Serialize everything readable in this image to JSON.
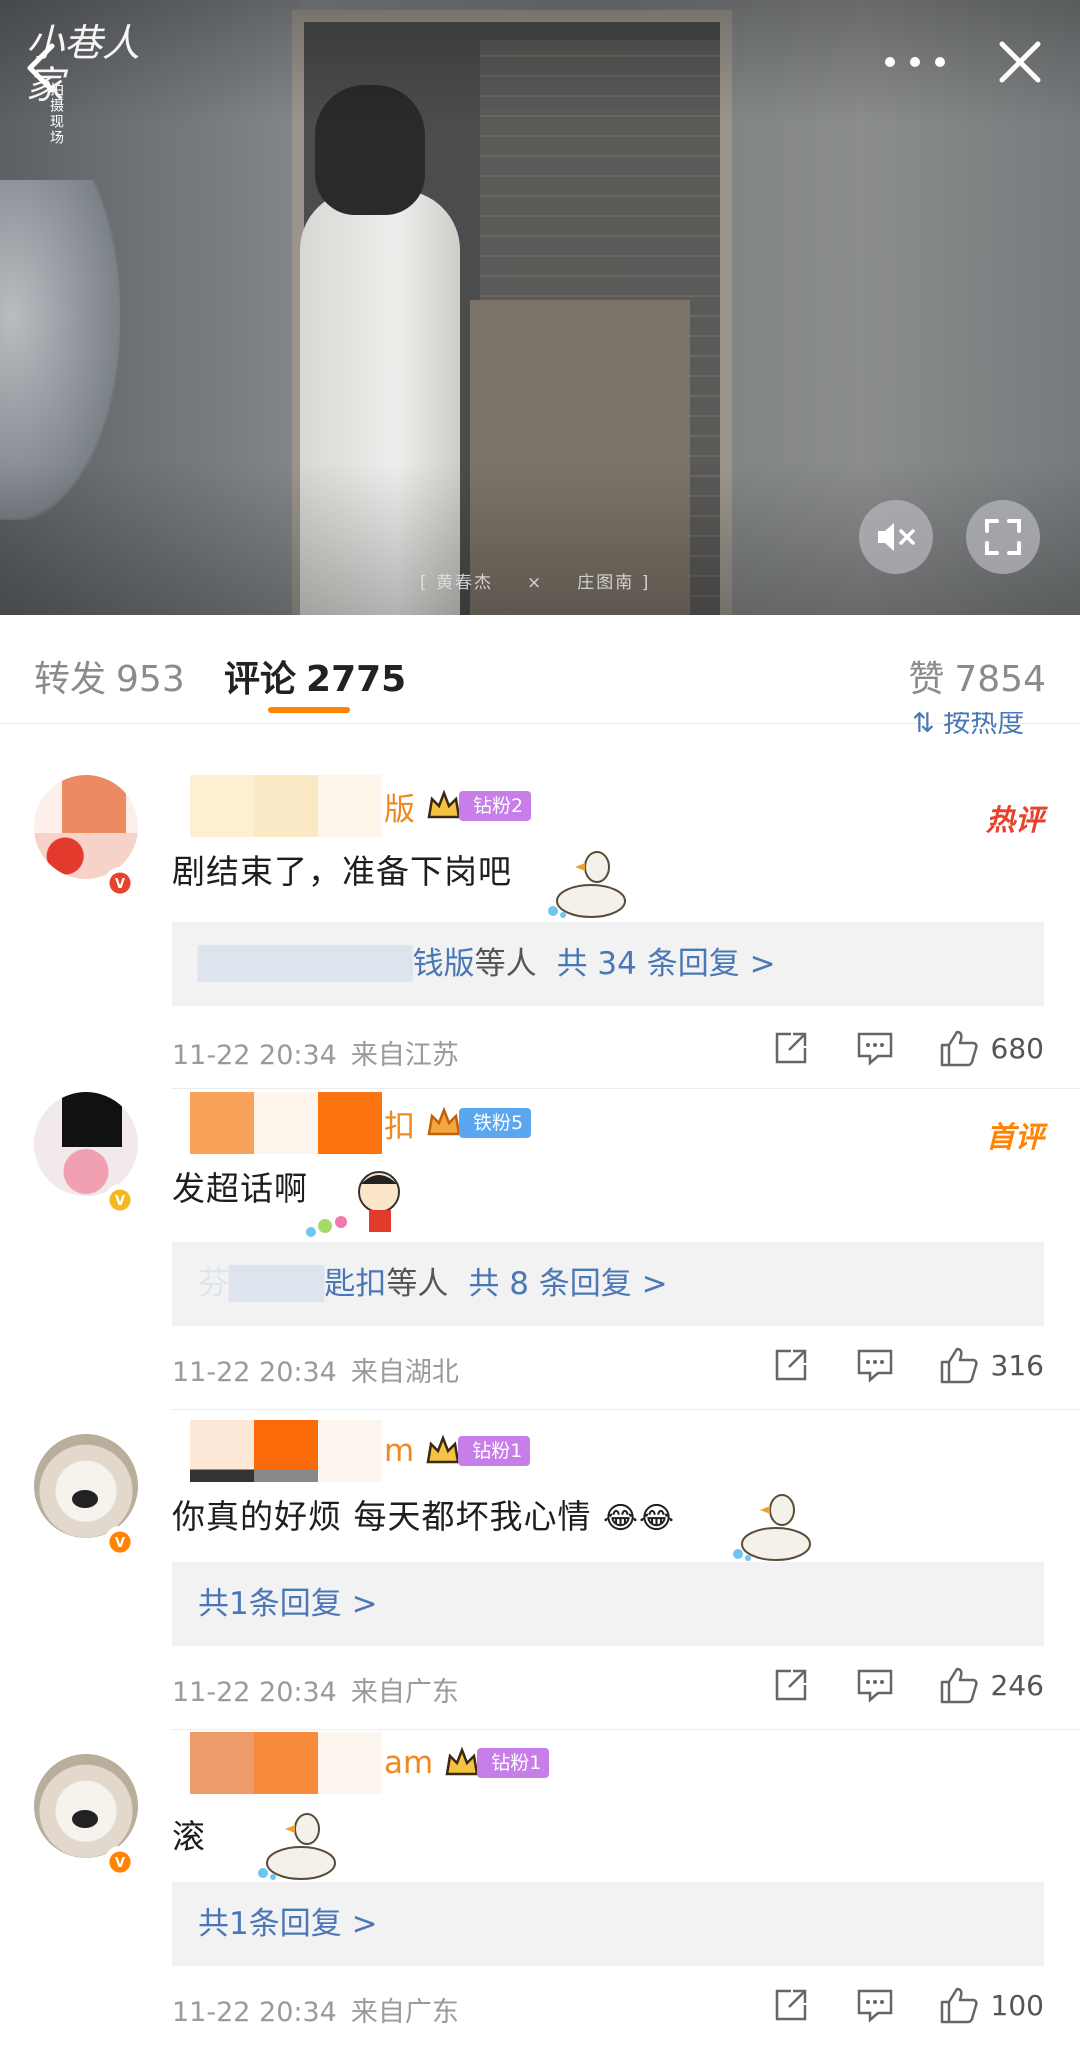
{
  "video": {
    "watermark": {
      "logo": "小巷人家",
      "subtitle": "拍摄现场"
    },
    "caption_left": "[ 黄春杰",
    "caption_mark": "×",
    "caption_right": "庄图南 ]"
  },
  "stats": {
    "repost_label": "转发",
    "repost_count": "953",
    "comment_label": "评论",
    "comment_count": "2775",
    "like_label": "赞",
    "like_count": "7854"
  },
  "sort_label": "按热度",
  "comments": [
    {
      "name_visible": "版",
      "name_color": "#f08a1e",
      "fan_badge": "钻粉2",
      "fan_badge_color": "#c77ee8",
      "tag": "热评",
      "tag_color": "#e8412c",
      "text": "剧结束了，准备下岗吧",
      "replies_blur": "",
      "replies_who": "钱版",
      "replies_etal": "等人",
      "replies_total": "共 34 条回复 >",
      "time": "11-22 20:34",
      "location": "来自江苏",
      "likes": "680",
      "vbadge_color": "#e8412c"
    },
    {
      "name_visible": "扣",
      "name_color": "#f08a1e",
      "fan_badge": "铁粉5",
      "fan_badge_color": "#5aa7f0",
      "tag": "首评",
      "tag_color": "#ff8200",
      "text": "发超话啊",
      "replies_blur": "芬",
      "replies_who": "匙扣",
      "replies_etal": "等人",
      "replies_total": "共 8 条回复 >",
      "time": "11-22 20:34",
      "location": "来自湖北",
      "likes": "316",
      "vbadge_color": "#f5b820"
    },
    {
      "name_visible": "m",
      "name_color": "#f08a1e",
      "fan_badge": "钻粉1",
      "fan_badge_color": "#c77ee8",
      "tag": "",
      "tag_color": "#ff8200",
      "text": "你真的好烦 每天都坏我心情",
      "replies_total": "共1条回复 >",
      "time": "11-22 20:34",
      "location": "来自广东",
      "likes": "246",
      "vbadge_color": "#ff8200"
    },
    {
      "name_visible": "am",
      "name_color": "#f08a1e",
      "fan_badge": "钻粉1",
      "fan_badge_color": "#c77ee8",
      "tag": "",
      "tag_color": "#ff8200",
      "text": "滚",
      "replies_total": "共1条回复 >",
      "time": "11-22 20:34",
      "location": "来自广东",
      "likes": "100",
      "vbadge_color": "#ff8200"
    }
  ],
  "icons": {
    "back": "chevron-left-icon",
    "more": "more-icon",
    "close": "close-icon",
    "mute": "mute-icon",
    "fullscreen": "fullscreen-icon",
    "share": "share-icon",
    "reply": "comment-icon",
    "like": "thumbs-up-icon"
  },
  "colors": {
    "accent": "#ff8200",
    "link": "#4a78b6",
    "hot": "#e8412c"
  }
}
